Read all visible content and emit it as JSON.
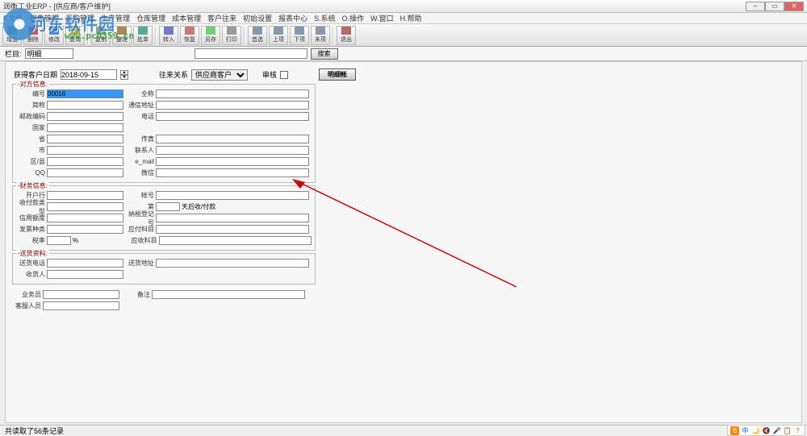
{
  "window": {
    "title": "润衡工业ERP - [供应商/客户维护]"
  },
  "menu": [
    "F.文件",
    "销售管理",
    "采购管理",
    "生产管理",
    "仓库管理",
    "成本管理",
    "客户往来",
    "初始设置",
    "报表中心",
    "S.系统",
    "O.操作",
    "W.窗口",
    "H.帮助"
  ],
  "toolbar": [
    "增加",
    "删除",
    "修改",
    "查询",
    "复制",
    "整理",
    "批单",
    "转入",
    "恢复",
    "另存",
    "打印",
    "首选",
    "上项",
    "下项",
    "末项",
    "退出"
  ],
  "watermark": {
    "text": "河东软件园",
    "url": "www.pc0359.cn"
  },
  "secondbar": {
    "label": "栏目:",
    "combo": "明细",
    "searchbtn": "搜索"
  },
  "toprow": {
    "datelabel": "获得客户日期",
    "date": "2018-09-15",
    "rellabel": "往来关系",
    "relvalue": "供应商客户",
    "auditlabel": "审核",
    "btn": "明细帐"
  },
  "panels": {
    "p1": {
      "legend": "-对方信息:",
      "left": [
        "编号",
        "简称",
        "邮政编码",
        "国家",
        "省",
        "市",
        "区/县",
        "QQ"
      ],
      "right": [
        "全称",
        "通信地址",
        "电话",
        "",
        "传真",
        "联系人",
        "e_mail",
        "微信"
      ],
      "code": "00016"
    },
    "p2": {
      "legend": "-财务信息:",
      "left": [
        "开户行",
        "收付款类型",
        "信用额度",
        "发票种类",
        "税率"
      ],
      "right": [
        "帐号",
        "第",
        "纳税登记号",
        "应付科目",
        "应收科目"
      ],
      "extra": "天后收/付款",
      "pct": "%"
    },
    "p3": {
      "legend": "-送货资料:",
      "left": [
        "送货电话",
        "收货人"
      ],
      "right": [
        "送货地址"
      ]
    },
    "free": {
      "left": [
        "业务员",
        "客服人员"
      ],
      "right": [
        "备注"
      ]
    }
  },
  "status": "共读取了56条记录",
  "tray": [
    "S",
    "中",
    "🌙",
    "🔇",
    "🎤",
    "📋",
    "?"
  ]
}
